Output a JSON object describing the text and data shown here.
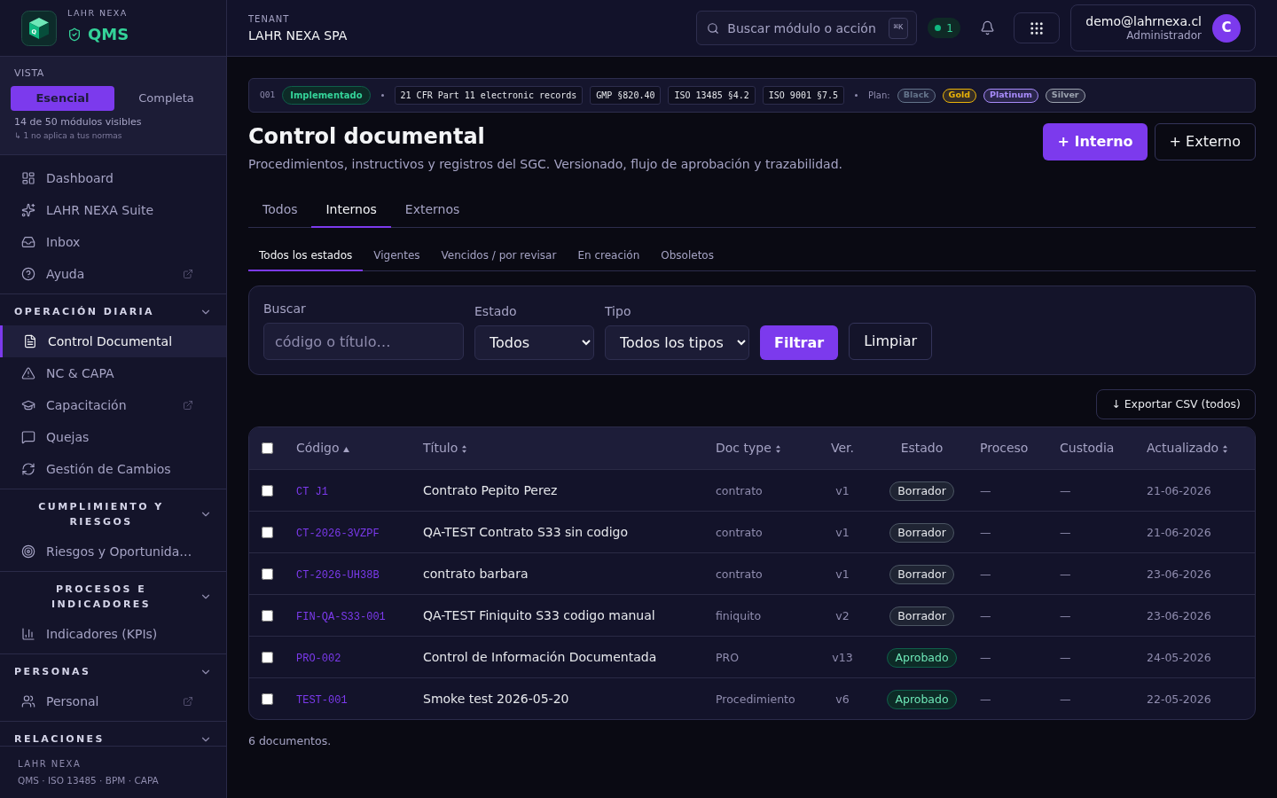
{
  "sidebar": {
    "brand": {
      "logo_letter": "Q",
      "company": "LAHR NEXA",
      "product": "QMS"
    },
    "view": {
      "label": "VISTA",
      "options": [
        {
          "label": "Esencial",
          "selected": true
        },
        {
          "label": "Completa",
          "selected": false
        }
      ],
      "summary": "14 de 50 módulos visibles",
      "note": "↳ 1 no aplica a tus normas"
    },
    "items": [
      {
        "label": "Dashboard",
        "external": false,
        "selected": false
      },
      {
        "label": "LAHR NEXA Suite",
        "external": false,
        "selected": false
      },
      {
        "label": "Inbox",
        "external": false,
        "selected": false
      },
      {
        "label": "Ayuda",
        "external": true,
        "selected": false
      }
    ],
    "sections": [
      {
        "title": "OPERACIÓN DIARIA",
        "expanded": true,
        "items": [
          {
            "label": "Control Documental",
            "external": false,
            "selected": true
          },
          {
            "label": "NC & CAPA",
            "external": false,
            "selected": false
          },
          {
            "label": "Capacitación",
            "external": true,
            "selected": false
          },
          {
            "label": "Quejas",
            "external": false,
            "selected": false
          },
          {
            "label": "Gestión de Cambios",
            "external": false,
            "selected": false
          }
        ]
      },
      {
        "title": "CUMPLIMIENTO Y RIESGOS",
        "expanded": true,
        "items": [
          {
            "label": "Riesgos y Oportunida…",
            "external": false,
            "selected": false
          }
        ]
      },
      {
        "title": "PROCESOS E INDICADORES",
        "expanded": true,
        "items": [
          {
            "label": "Indicadores (KPIs)",
            "external": false,
            "selected": false
          }
        ]
      },
      {
        "title": "PERSONAS",
        "expanded": true,
        "items": [
          {
            "label": "Personal",
            "external": true,
            "selected": false
          }
        ]
      },
      {
        "title": "RELACIONES",
        "expanded": true
      }
    ],
    "footer": {
      "company": "LAHR NEXA",
      "tagline": "QMS · ISO 13485 · BPM · CAPA"
    }
  },
  "topbar": {
    "tenant_label": "TENANT",
    "tenant": "LAHR NEXA SPA",
    "search": {
      "placeholder": "Buscar módulo o acción",
      "shortcut": "⌘K"
    },
    "online_count": "1",
    "user": {
      "email": "demo@lahrnexa.cl",
      "role": "Administrador",
      "initial": "C"
    }
  },
  "standards_bar": {
    "code": "Q01",
    "status": "Implementado",
    "references": [
      "21 CFR Part 11 electronic records",
      "GMP §820.40",
      "ISO 13485 §4.2",
      "ISO 9001 §7.5"
    ],
    "plan_label": "Plan:",
    "plans": [
      {
        "label": "Black",
        "color": "#64748b"
      },
      {
        "label": "Gold",
        "color": "#eab308"
      },
      {
        "label": "Platinum",
        "color": "#a78bfa"
      },
      {
        "label": "Silver",
        "color": "#9ca3af"
      }
    ]
  },
  "header": {
    "title": "Control documental",
    "subtitle": "Procedimientos, instructivos y registros del SGC. Versionado, flujo de aprobación y trazabilidad.",
    "actions": [
      {
        "label": "+ Interno",
        "kind": "primary"
      },
      {
        "label": "+ Externo",
        "kind": "secondary"
      }
    ]
  },
  "tabs": [
    {
      "label": "Todos",
      "selected": false
    },
    {
      "label": "Internos",
      "selected": true
    },
    {
      "label": "Externos",
      "selected": false
    }
  ],
  "status_tabs": [
    {
      "label": "Todos los estados",
      "selected": true
    },
    {
      "label": "Vigentes",
      "selected": false
    },
    {
      "label": "Vencidos / por revisar",
      "selected": false
    },
    {
      "label": "En creación",
      "selected": false
    },
    {
      "label": "Obsoletos",
      "selected": false
    }
  ],
  "filters": {
    "search": {
      "label": "Buscar",
      "placeholder": "código o título…"
    },
    "status": {
      "label": "Estado",
      "value": "Todos"
    },
    "type": {
      "label": "Tipo",
      "value": "Todos los tipos"
    },
    "buttons": [
      {
        "label": "Filtrar",
        "kind": "primary"
      },
      {
        "label": "Limpiar",
        "kind": "secondary"
      }
    ]
  },
  "export_button": "↓ Exportar CSV (todos)",
  "table": {
    "select_all": {
      "checked": false
    },
    "columns": [
      {
        "label": "Código",
        "sortable": true,
        "sorted": true
      },
      {
        "label": "Título",
        "sortable": true,
        "sorted": false
      },
      {
        "label": "Doc type",
        "sortable": true,
        "sorted": false
      },
      {
        "label": "Ver.",
        "sortable": false,
        "sorted": false
      },
      {
        "label": "Estado",
        "sortable": false,
        "sorted": false
      },
      {
        "label": "Proceso",
        "sortable": false,
        "sorted": false
      },
      {
        "label": "Custodia",
        "sortable": false,
        "sorted": false
      },
      {
        "label": "Actualizado",
        "sortable": true,
        "sorted": false
      }
    ],
    "rows": [
      {
        "checked": false,
        "code": "CT J1",
        "title": "Contrato Pepito Perez",
        "doc_type": "contrato",
        "version": "v1",
        "status": {
          "label": "Borrador",
          "kind": "draft"
        },
        "process": "—",
        "custody": "—",
        "updated": "21-06-2026"
      },
      {
        "checked": false,
        "code": "CT-2026-3VZPF",
        "title": "QA-TEST Contrato S33 sin codigo",
        "doc_type": "contrato",
        "version": "v1",
        "status": {
          "label": "Borrador",
          "kind": "draft"
        },
        "process": "—",
        "custody": "—",
        "updated": "21-06-2026"
      },
      {
        "checked": false,
        "code": "CT-2026-UH38B",
        "title": "contrato barbara",
        "doc_type": "contrato",
        "version": "v1",
        "status": {
          "label": "Borrador",
          "kind": "draft"
        },
        "process": "—",
        "custody": "—",
        "updated": "23-06-2026"
      },
      {
        "checked": false,
        "code": "FIN-QA-S33-001",
        "title": "QA-TEST Finiquito S33 codigo manual",
        "doc_type": "finiquito",
        "version": "v2",
        "status": {
          "label": "Borrador",
          "kind": "draft"
        },
        "process": "—",
        "custody": "—",
        "updated": "23-06-2026"
      },
      {
        "checked": false,
        "code": "PRO-002",
        "title": "Control de Información Documentada",
        "doc_type": "PRO",
        "version": "v13",
        "status": {
          "label": "Aprobado",
          "kind": "approved"
        },
        "process": "—",
        "custody": "—",
        "updated": "24-05-2026"
      },
      {
        "checked": false,
        "code": "TEST-001",
        "title": "Smoke test 2026-05-20",
        "doc_type": "Procedimiento",
        "version": "v6",
        "status": {
          "label": "Aprobado",
          "kind": "approved"
        },
        "process": "—",
        "custody": "—",
        "updated": "22-05-2026"
      }
    ]
  },
  "footer_count": "6 documentos."
}
